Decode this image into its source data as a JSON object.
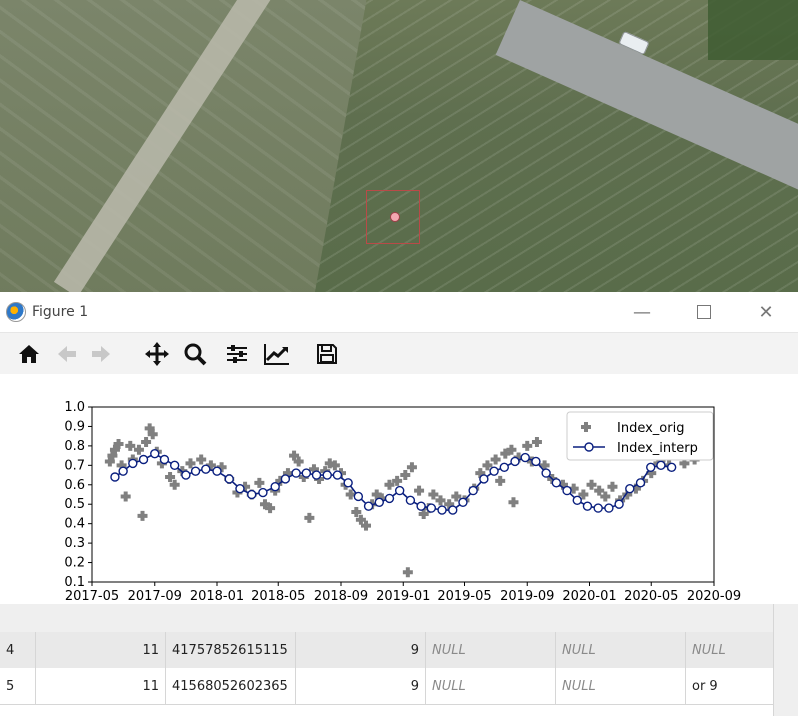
{
  "window": {
    "title": "Figure 1"
  },
  "toolbar": {
    "buttons": [
      {
        "name": "home-icon"
      },
      {
        "name": "back-icon"
      },
      {
        "name": "forward-icon"
      },
      {
        "name": "pan-icon"
      },
      {
        "name": "zoom-icon"
      },
      {
        "name": "configure-subplots-icon"
      },
      {
        "name": "edit-axes-icon"
      },
      {
        "name": "save-icon"
      }
    ]
  },
  "chart_data": {
    "type": "line",
    "title": "",
    "xlabel": "",
    "ylabel": "",
    "ylim": [
      0.1,
      1.0
    ],
    "yticks": [
      "0.1",
      "0.2",
      "0.3",
      "0.4",
      "0.5",
      "0.6",
      "0.7",
      "0.8",
      "0.9",
      "1.0"
    ],
    "xlim": [
      "2017-05-01",
      "2020-09-01"
    ],
    "xticks": [
      "2017-05",
      "2017-09",
      "2018-01",
      "2018-05",
      "2018-09",
      "2019-01",
      "2019-05",
      "2019-09",
      "2020-01",
      "2020-05",
      "2020-09"
    ],
    "legend": {
      "placement": "top-right",
      "entries": [
        "Index_orig",
        "Index_interp"
      ]
    },
    "colors": {
      "orig": "#808080",
      "interp": "#0a1f7f"
    },
    "series": [
      {
        "name": "Index_orig",
        "marker": "plus",
        "points": [
          [
            "2017-06-05",
            0.72
          ],
          [
            "2017-06-10",
            0.75
          ],
          [
            "2017-06-15",
            0.78
          ],
          [
            "2017-06-22",
            0.81
          ],
          [
            "2017-06-28",
            0.7
          ],
          [
            "2017-07-06",
            0.54
          ],
          [
            "2017-07-15",
            0.8
          ],
          [
            "2017-07-20",
            0.73
          ],
          [
            "2017-08-01",
            0.78
          ],
          [
            "2017-08-08",
            0.44
          ],
          [
            "2017-08-15",
            0.82
          ],
          [
            "2017-08-22",
            0.89
          ],
          [
            "2017-08-28",
            0.86
          ],
          [
            "2017-09-05",
            0.77
          ],
          [
            "2017-09-15",
            0.71
          ],
          [
            "2017-10-01",
            0.64
          ],
          [
            "2017-10-10",
            0.6
          ],
          [
            "2017-10-25",
            0.67
          ],
          [
            "2017-11-10",
            0.71
          ],
          [
            "2017-12-01",
            0.73
          ],
          [
            "2017-12-20",
            0.7
          ],
          [
            "2018-01-10",
            0.69
          ],
          [
            "2018-01-25",
            0.63
          ],
          [
            "2018-02-10",
            0.56
          ],
          [
            "2018-02-25",
            0.59
          ],
          [
            "2018-03-10",
            0.55
          ],
          [
            "2018-03-25",
            0.61
          ],
          [
            "2018-04-05",
            0.5
          ],
          [
            "2018-04-15",
            0.48
          ],
          [
            "2018-04-25",
            0.57
          ],
          [
            "2018-05-05",
            0.62
          ],
          [
            "2018-05-20",
            0.66
          ],
          [
            "2018-06-01",
            0.75
          ],
          [
            "2018-06-10",
            0.72
          ],
          [
            "2018-06-20",
            0.64
          ],
          [
            "2018-07-01",
            0.43
          ],
          [
            "2018-07-10",
            0.68
          ],
          [
            "2018-07-20",
            0.63
          ],
          [
            "2018-08-01",
            0.67
          ],
          [
            "2018-08-10",
            0.71
          ],
          [
            "2018-08-20",
            0.7
          ],
          [
            "2018-09-01",
            0.66
          ],
          [
            "2018-09-10",
            0.6
          ],
          [
            "2018-09-20",
            0.55
          ],
          [
            "2018-10-01",
            0.46
          ],
          [
            "2018-10-10",
            0.42
          ],
          [
            "2018-10-20",
            0.39
          ],
          [
            "2018-11-01",
            0.5
          ],
          [
            "2018-11-10",
            0.55
          ],
          [
            "2018-11-20",
            0.53
          ],
          [
            "2018-12-05",
            0.6
          ],
          [
            "2018-12-20",
            0.62
          ],
          [
            "2019-01-05",
            0.65
          ],
          [
            "2019-01-10",
            0.15
          ],
          [
            "2019-01-18",
            0.69
          ],
          [
            "2019-02-01",
            0.57
          ],
          [
            "2019-02-10",
            0.45
          ],
          [
            "2019-02-20",
            0.48
          ],
          [
            "2019-03-01",
            0.55
          ],
          [
            "2019-03-15",
            0.52
          ],
          [
            "2019-04-01",
            0.5
          ],
          [
            "2019-04-15",
            0.54
          ],
          [
            "2019-05-01",
            0.52
          ],
          [
            "2019-05-20",
            0.58
          ],
          [
            "2019-06-01",
            0.66
          ],
          [
            "2019-06-15",
            0.7
          ],
          [
            "2019-07-01",
            0.73
          ],
          [
            "2019-07-10",
            0.62
          ],
          [
            "2019-07-20",
            0.76
          ],
          [
            "2019-08-01",
            0.78
          ],
          [
            "2019-08-05",
            0.51
          ],
          [
            "2019-08-15",
            0.74
          ],
          [
            "2019-09-01",
            0.8
          ],
          [
            "2019-09-10",
            0.72
          ],
          [
            "2019-09-20",
            0.82
          ],
          [
            "2019-10-05",
            0.7
          ],
          [
            "2019-10-20",
            0.63
          ],
          [
            "2019-11-10",
            0.6
          ],
          [
            "2019-12-01",
            0.58
          ],
          [
            "2019-12-20",
            0.55
          ],
          [
            "2020-01-05",
            0.6
          ],
          [
            "2020-01-20",
            0.57
          ],
          [
            "2020-02-01",
            0.54
          ],
          [
            "2020-02-15",
            0.59
          ],
          [
            "2020-03-01",
            0.52
          ],
          [
            "2020-03-15",
            0.55
          ],
          [
            "2020-04-01",
            0.58
          ],
          [
            "2020-04-15",
            0.62
          ],
          [
            "2020-05-01",
            0.66
          ],
          [
            "2020-05-15",
            0.71
          ],
          [
            "2020-05-25",
            0.74
          ],
          [
            "2020-06-05",
            0.7
          ],
          [
            "2020-06-20",
            0.76
          ],
          [
            "2020-07-05",
            0.71
          ],
          [
            "2020-07-25",
            0.73
          ]
        ]
      },
      {
        "name": "Index_interp",
        "marker": "open-circle",
        "points": [
          [
            "2017-06-15",
            0.64
          ],
          [
            "2017-07-01",
            0.67
          ],
          [
            "2017-07-20",
            0.71
          ],
          [
            "2017-08-10",
            0.73
          ],
          [
            "2017-09-01",
            0.76
          ],
          [
            "2017-09-20",
            0.73
          ],
          [
            "2017-10-10",
            0.7
          ],
          [
            "2017-11-01",
            0.65
          ],
          [
            "2017-11-20",
            0.67
          ],
          [
            "2017-12-10",
            0.68
          ],
          [
            "2018-01-01",
            0.67
          ],
          [
            "2018-01-25",
            0.63
          ],
          [
            "2018-02-15",
            0.58
          ],
          [
            "2018-03-10",
            0.55
          ],
          [
            "2018-04-01",
            0.56
          ],
          [
            "2018-04-25",
            0.59
          ],
          [
            "2018-05-15",
            0.63
          ],
          [
            "2018-06-05",
            0.66
          ],
          [
            "2018-06-25",
            0.66
          ],
          [
            "2018-07-15",
            0.65
          ],
          [
            "2018-08-05",
            0.65
          ],
          [
            "2018-08-25",
            0.65
          ],
          [
            "2018-09-15",
            0.61
          ],
          [
            "2018-10-05",
            0.54
          ],
          [
            "2018-10-25",
            0.49
          ],
          [
            "2018-11-15",
            0.51
          ],
          [
            "2018-12-05",
            0.53
          ],
          [
            "2018-12-25",
            0.57
          ],
          [
            "2019-01-15",
            0.52
          ],
          [
            "2019-02-05",
            0.49
          ],
          [
            "2019-02-25",
            0.48
          ],
          [
            "2019-03-18",
            0.47
          ],
          [
            "2019-04-08",
            0.47
          ],
          [
            "2019-04-28",
            0.51
          ],
          [
            "2019-05-18",
            0.57
          ],
          [
            "2019-06-08",
            0.63
          ],
          [
            "2019-06-28",
            0.67
          ],
          [
            "2019-07-18",
            0.69
          ],
          [
            "2019-08-08",
            0.72
          ],
          [
            "2019-08-28",
            0.74
          ],
          [
            "2019-09-18",
            0.72
          ],
          [
            "2019-10-08",
            0.66
          ],
          [
            "2019-10-28",
            0.61
          ],
          [
            "2019-11-18",
            0.57
          ],
          [
            "2019-12-08",
            0.52
          ],
          [
            "2019-12-28",
            0.49
          ],
          [
            "2020-01-18",
            0.48
          ],
          [
            "2020-02-08",
            0.48
          ],
          [
            "2020-02-28",
            0.5
          ],
          [
            "2020-03-20",
            0.58
          ],
          [
            "2020-04-10",
            0.61
          ],
          [
            "2020-04-30",
            0.69
          ],
          [
            "2020-05-20",
            0.7
          ],
          [
            "2020-06-10",
            0.69
          ]
        ]
      }
    ]
  },
  "table": {
    "rows": [
      {
        "id": "4",
        "c1": "11",
        "c2": "41757852615115",
        "c3": "9",
        "c4": "NULL",
        "c5": "NULL",
        "c6": "NULL"
      },
      {
        "id": "5",
        "c1": "11",
        "c2": "41568052602365",
        "c3": "9",
        "c4": "NULL",
        "c5": "NULL",
        "c6": "or 9"
      }
    ]
  }
}
